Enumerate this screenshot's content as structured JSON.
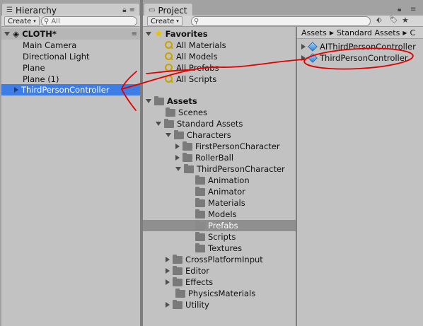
{
  "hierarchy": {
    "tab_label": "Hierarchy",
    "create_label": "Create",
    "search_placeholder": "All",
    "scene_name": "CLOTH*",
    "items": [
      "Main Camera",
      "Directional Light",
      "Plane",
      "Plane (1)",
      "ThirdPersonController"
    ]
  },
  "project": {
    "tab_label": "Project",
    "create_label": "Create",
    "favorites": {
      "label": "Favorites",
      "items": [
        "All Materials",
        "All Models",
        "All Prefabs",
        "All Scripts"
      ]
    },
    "assets_label": "Assets",
    "tree": {
      "scenes": "Scenes",
      "standard_assets": "Standard Assets",
      "characters": "Characters",
      "first_person": "FirstPersonCharacter",
      "rollerball": "RollerBall",
      "third_person": "ThirdPersonCharacter",
      "animation": "Animation",
      "animator": "Animator",
      "materials": "Materials",
      "models": "Models",
      "prefabs": "Prefabs",
      "scripts": "Scripts",
      "textures": "Textures",
      "cross_platform": "CrossPlatformInput",
      "editor": "Editor",
      "effects": "Effects",
      "physics_materials": "PhysicsMaterials",
      "utility": "Utility"
    },
    "breadcrumb": [
      "Assets",
      "Standard Assets",
      "C"
    ],
    "files": [
      "AIThirdPersonController",
      "ThirdPersonController"
    ]
  },
  "colors": {
    "selection": "#3e7de6",
    "annotation": "#e00000"
  }
}
